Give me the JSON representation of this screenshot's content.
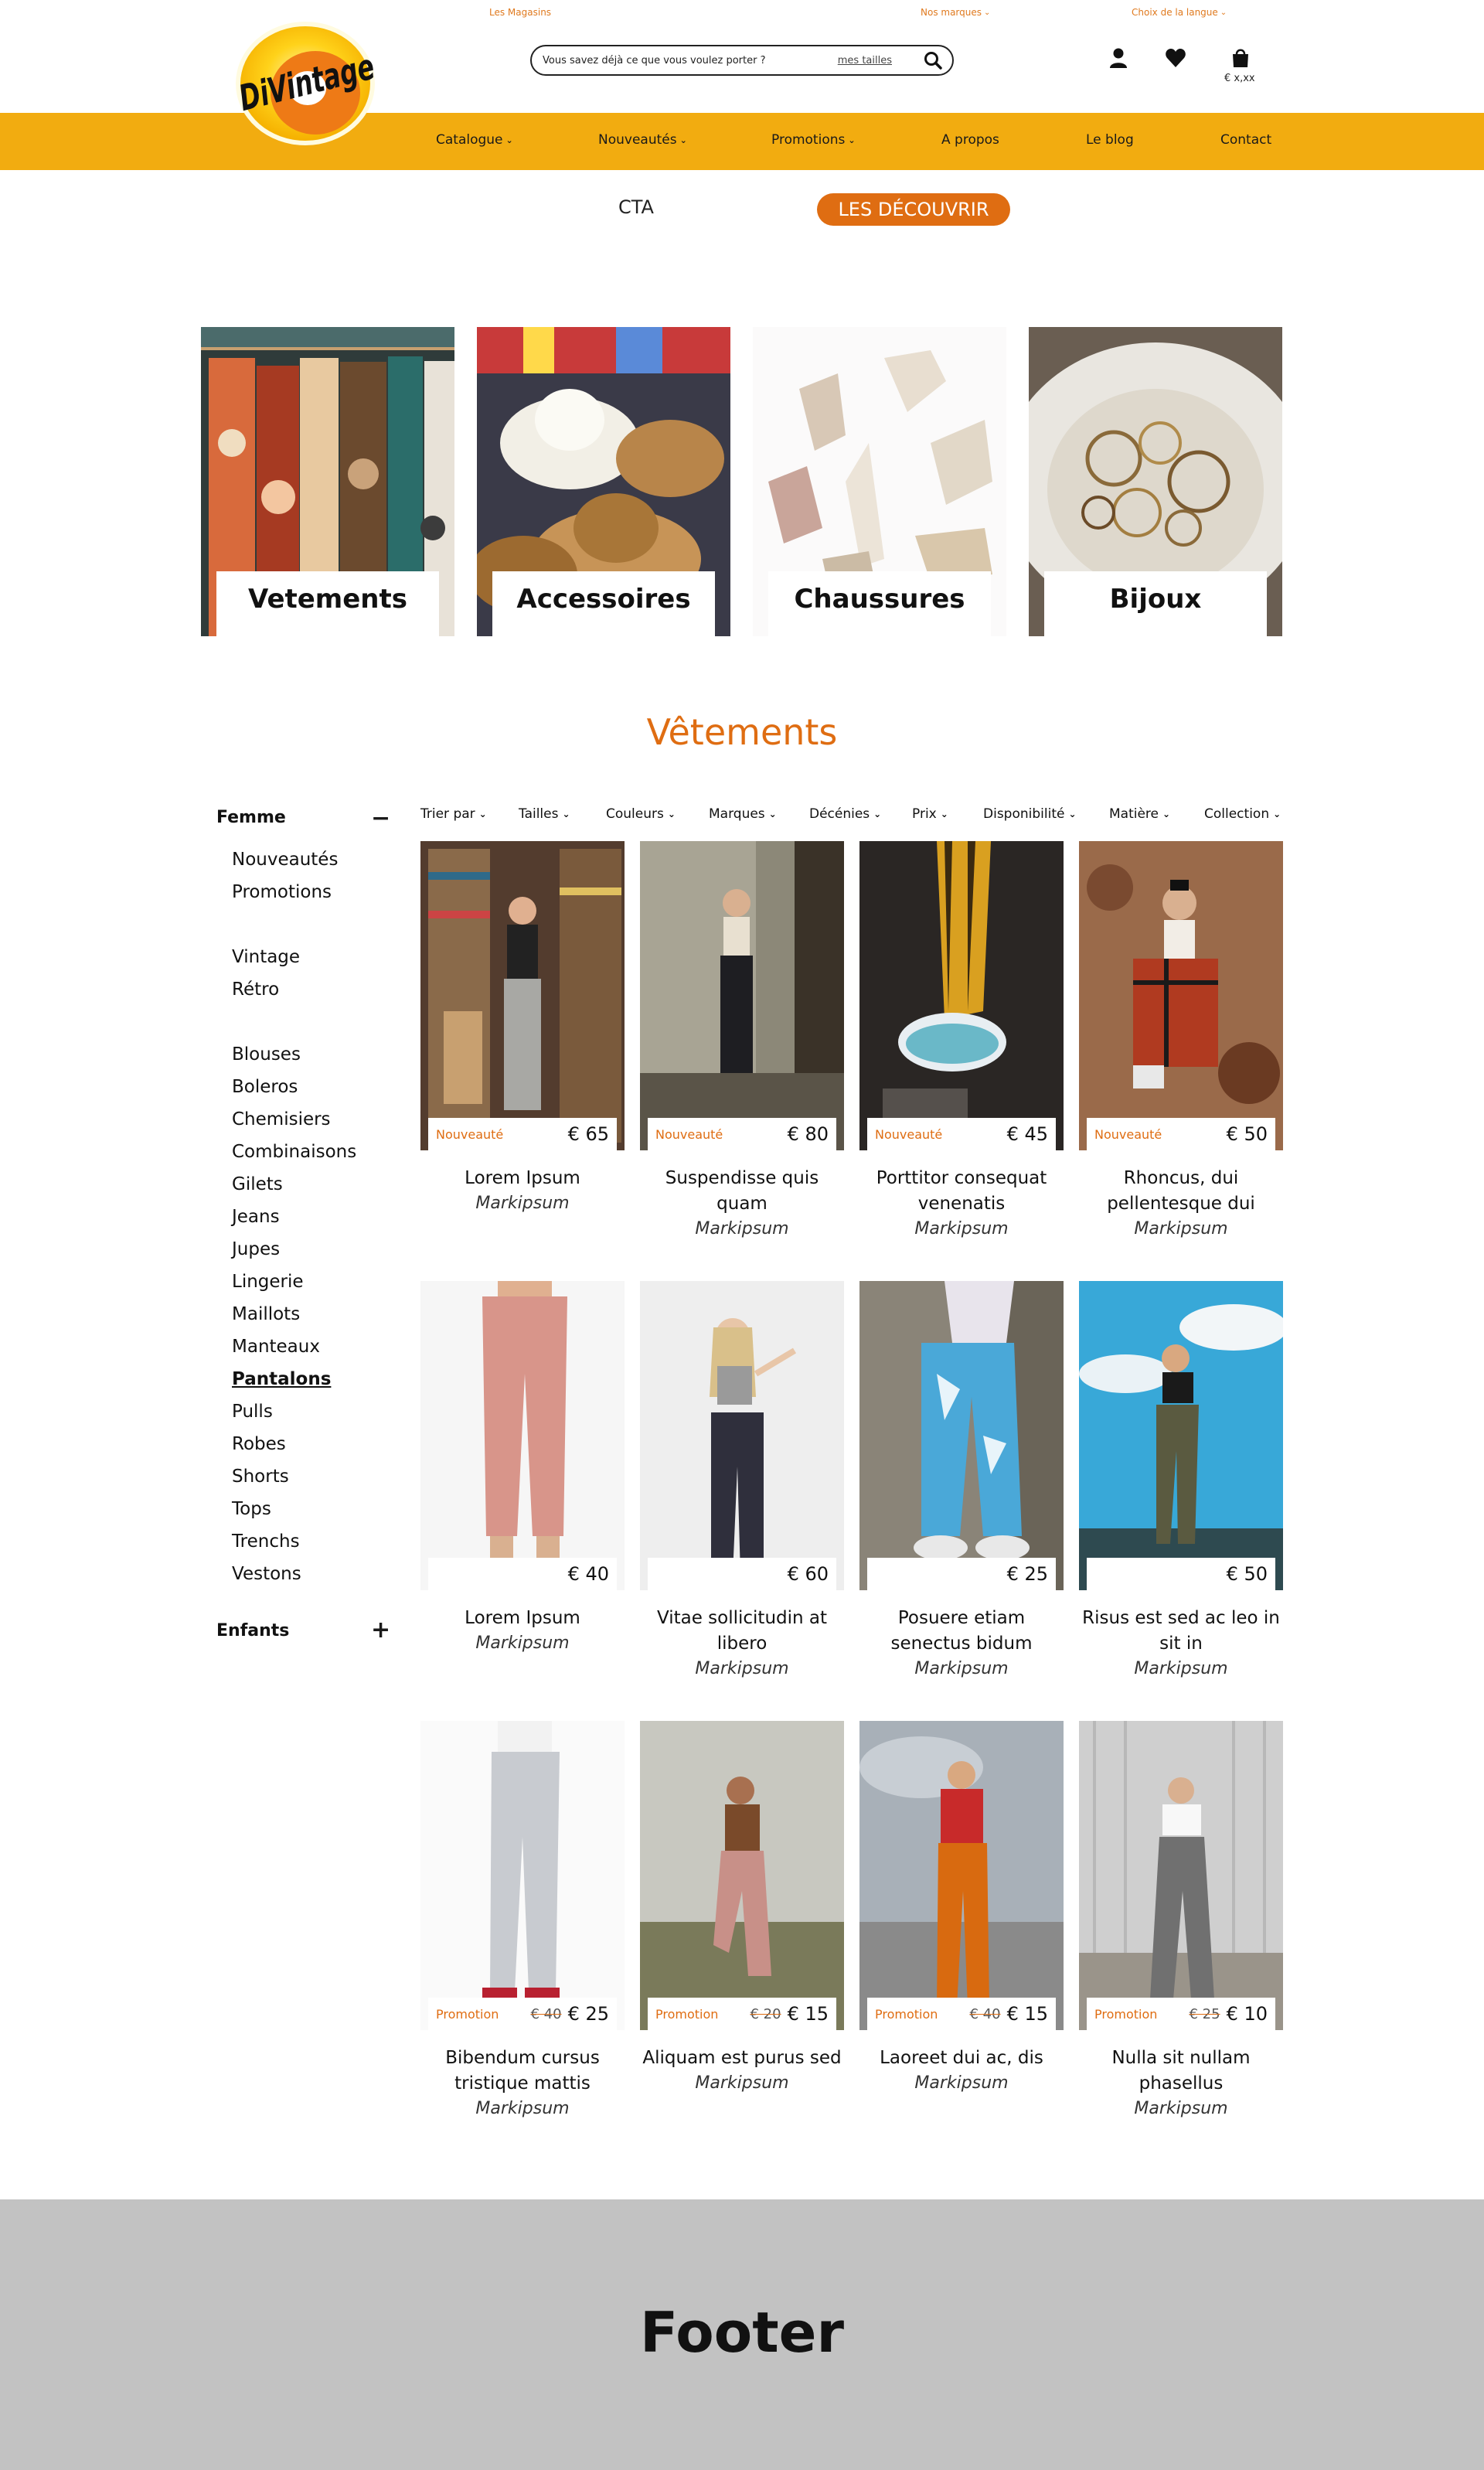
{
  "header": {
    "stores_link": "Les Magasins",
    "brands_link": "Nos marques",
    "language_link": "Choix de la langue",
    "logo_text": "DiVintage",
    "search_placeholder": "Vous savez déjà ce que vous voulez porter ?",
    "search_sizes_link": "mes tailles",
    "cart_amount": "€ x,xx",
    "icons": [
      "search-icon",
      "user-icon",
      "heart-icon",
      "bag-icon",
      "chevron-down-icon"
    ]
  },
  "nav": {
    "items": [
      "Catalogue",
      "Nouveautés",
      "Promotions",
      "A propos",
      "Le blog",
      "Contact"
    ]
  },
  "cta": {
    "label": "CTA",
    "button": "LES DÉCOUVRIR"
  },
  "categories": [
    "Vetements",
    "Accessoires",
    "Chaussures",
    "Bijoux"
  ],
  "section_title": "Vêtements",
  "sidebar": {
    "femme": {
      "title": "Femme",
      "toggle": "−",
      "groups": [
        [
          "Nouveautés",
          "Promotions"
        ],
        [
          "Vintage",
          "Rétro"
        ],
        [
          "Blouses",
          "Boleros",
          "Chemisiers",
          "Combinaisons",
          "Gilets",
          "Jeans",
          "Jupes",
          "Lingerie",
          "Maillots",
          "Manteaux",
          "Pantalons",
          "Pulls",
          "Robes",
          "Shorts",
          "Tops",
          "Trenchs",
          "Vestons"
        ]
      ],
      "active_item": "Pantalons"
    },
    "enfants": {
      "title": "Enfants",
      "toggle": "+"
    }
  },
  "filters": [
    "Trier par",
    "Tailles",
    "Couleurs",
    "Marques",
    "Décénies",
    "Prix",
    "Disponibilité",
    "Matière",
    "Collection"
  ],
  "products": [
    {
      "tag": "Nouveauté",
      "old_price": "",
      "price": "€ 65",
      "name": "Lorem Ipsum",
      "brand": "Markipsum"
    },
    {
      "tag": "Nouveauté",
      "old_price": "",
      "price": "€ 80",
      "name": "Suspendisse quis quam",
      "brand": "Markipsum"
    },
    {
      "tag": "Nouveauté",
      "old_price": "",
      "price": "€ 45",
      "name": "Porttitor consequat venenatis",
      "brand": "Markipsum"
    },
    {
      "tag": "Nouveauté",
      "old_price": "",
      "price": "€ 50",
      "name": "Rhoncus, dui pellentesque dui",
      "brand": "Markipsum"
    },
    {
      "tag": "",
      "old_price": "",
      "price": "€ 40",
      "name": "Lorem Ipsum",
      "brand": "Markipsum"
    },
    {
      "tag": "",
      "old_price": "",
      "price": "€ 60",
      "name": "Vitae sollicitudin at libero",
      "brand": "Markipsum"
    },
    {
      "tag": "",
      "old_price": "",
      "price": "€ 25",
      "name": "Posuere etiam senectus bidum",
      "brand": "Markipsum"
    },
    {
      "tag": "",
      "old_price": "",
      "price": "€ 50",
      "name": "Risus est sed ac leo in sit in",
      "brand": "Markipsum"
    },
    {
      "tag": "Promotion",
      "old_price": "€ 40",
      "price": "€ 25",
      "name": "Bibendum cursus tristique mattis",
      "brand": "Markipsum"
    },
    {
      "tag": "Promotion",
      "old_price": "€ 20",
      "price": "€ 15",
      "name": "Aliquam est purus sed",
      "brand": "Markipsum"
    },
    {
      "tag": "Promotion",
      "old_price": "€ 40",
      "price": "€ 15",
      "name": "Laoreet dui ac, dis",
      "brand": "Markipsum"
    },
    {
      "tag": "Promotion",
      "old_price": "€ 25",
      "price": "€ 10",
      "name": "Nulla sit nullam phasellus",
      "brand": "Markipsum"
    }
  ],
  "footer": {
    "title": "Footer"
  },
  "colors": {
    "accent_orange": "#df6d12",
    "nav_yellow": "#f2ac10",
    "footer_gray": "#c2c2c2"
  }
}
